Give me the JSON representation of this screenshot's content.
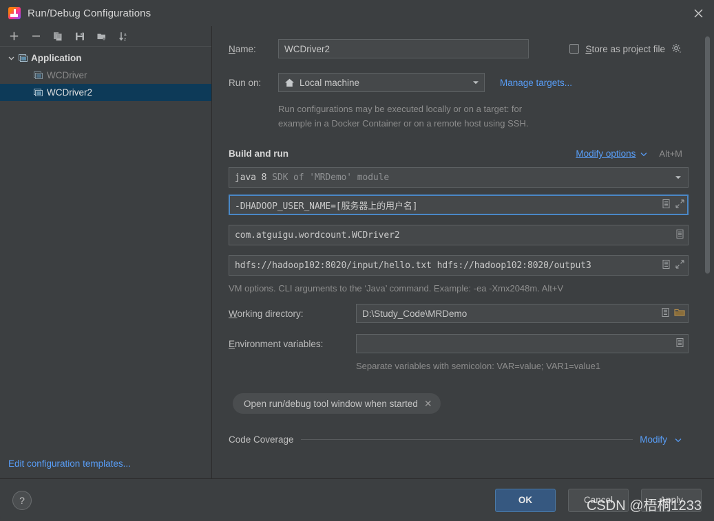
{
  "window": {
    "title": "Run/Debug Configurations",
    "close_icon": "close-icon",
    "app_icon": "intellij-idea-icon"
  },
  "sidebar": {
    "toolbar": [
      {
        "name": "add-configuration-button",
        "icon": "plus-icon",
        "tooltip": "Add New Configuration"
      },
      {
        "name": "remove-configuration-button",
        "icon": "minus-icon",
        "tooltip": "Remove Configuration"
      },
      {
        "name": "copy-configuration-button",
        "icon": "copy-icon",
        "tooltip": "Copy Configuration"
      },
      {
        "name": "save-configuration-button",
        "icon": "save-icon",
        "tooltip": "Save Configuration"
      },
      {
        "name": "move-into-folder-button",
        "icon": "new-folder-icon",
        "tooltip": "Move into new folder"
      },
      {
        "name": "sort-configurations-button",
        "icon": "sort-alphabetically-icon",
        "tooltip": "Sort Configurations"
      }
    ],
    "tree": {
      "group": {
        "label": "Application",
        "icon": "application-icon",
        "expanded": true,
        "chevron": "chevron-down-icon"
      },
      "items": [
        {
          "label": "WCDriver",
          "icon": "application-icon",
          "selected": false,
          "dimmed": true
        },
        {
          "label": "WCDriver2",
          "icon": "application-icon",
          "selected": true,
          "dimmed": false
        }
      ]
    },
    "edit_templates_link": "Edit configuration templates..."
  },
  "form": {
    "name_label": "Name:",
    "name_label_mnemonic": "N",
    "name_value": "WCDriver2",
    "store_as_project_file": {
      "label": "Store as project file",
      "mnemonic": "S",
      "checked": false,
      "gear_icon": "gear-icon"
    },
    "run_on_label": "Run on:",
    "run_on_value": "Local machine",
    "run_on_icon": "home-icon",
    "manage_targets_link": "Manage targets...",
    "run_on_hint_line1": "Run configurations may be executed locally or on a target: for",
    "run_on_hint_line2": "example in a Docker Container or on a remote host using SSH.",
    "build_and_run_title": "Build and run",
    "modify_options_link": "Modify options",
    "modify_options_shortcut": "Alt+M",
    "sdk_value_strong": "java 8",
    "sdk_value_dim": "SDK of 'MRDemo' module",
    "vm_options_value": "-DHADOOP_USER_NAME=[服务器上的用户名]",
    "vm_options_focused": true,
    "main_class_value": "com.atguigu.wordcount.WCDriver2",
    "program_arguments_value": "hdfs://hadoop102:8020/input/hello.txt hdfs://hadoop102:8020/output3",
    "vm_hint": "VM options. CLI arguments to the ‘Java’ command. Example: -ea -Xmx2048m. Alt+V",
    "working_directory_label": "Working directory:",
    "working_directory_mnemonic": "W",
    "working_directory_value": "D:\\Study_Code\\MRDemo",
    "environment_variables_label": "Environment variables:",
    "environment_variables_mnemonic": "E",
    "environment_variables_value": "",
    "environment_variables_hint": "Separate variables with semicolon: VAR=value; VAR1=value1",
    "chip_label": "Open run/debug tool window when started",
    "code_coverage_title": "Code Coverage",
    "code_coverage_modify_link": "Modify",
    "icons": {
      "expand_editor": "expand-icon",
      "insert_macro": "document-list-icon",
      "browse_folder": "folder-icon",
      "dropdown": "chevron-down-icon"
    }
  },
  "buttons": {
    "help": "?",
    "ok": "OK",
    "cancel": "Cancel",
    "apply": "Apply"
  },
  "watermark": "CSDN @梧桐1233",
  "colors": {
    "dialog_background": "#3c3f41",
    "field_background": "#45484a",
    "selection": "#0d3a58",
    "link": "#589df6",
    "primary_button": "#365880",
    "focus_border": "#4a88c7"
  }
}
